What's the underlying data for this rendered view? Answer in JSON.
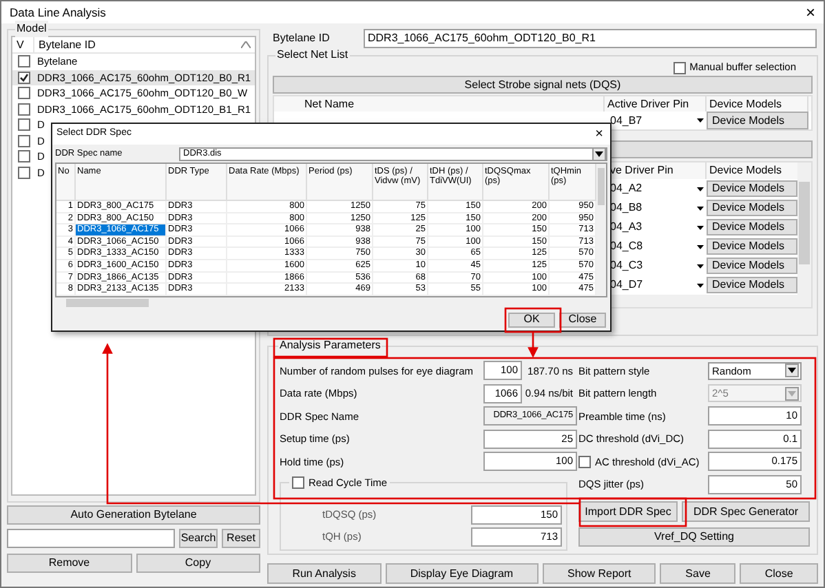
{
  "window": {
    "title": "Data Line Analysis",
    "close": "×"
  },
  "model": {
    "label": "Model",
    "columns": [
      "V",
      "Bytelane ID"
    ],
    "rows": [
      {
        "label": "Bytelane",
        "checked": false,
        "selected": false
      },
      {
        "label": "DDR3_1066_AC175_60ohm_ODT120_B0_R1",
        "checked": true,
        "selected": true
      },
      {
        "label": "DDR3_1066_AC175_60ohm_ODT120_B0_W",
        "checked": false,
        "selected": false
      },
      {
        "label": "DDR3_1066_AC175_60ohm_ODT120_B1_R1",
        "checked": false,
        "selected": false
      },
      {
        "label": "D",
        "checked": false,
        "selected": false
      },
      {
        "label": "D",
        "checked": false,
        "selected": false
      },
      {
        "label": "D",
        "checked": false,
        "selected": false
      },
      {
        "label": "D",
        "checked": false,
        "selected": false
      }
    ],
    "auto_button": "Auto Generation Bytelane",
    "search_button": "Search",
    "reset_button": "Reset",
    "remove_button": "Remove",
    "copy_button": "Copy"
  },
  "bytelane_id": {
    "label": "Bytelane ID",
    "value": "DDR3_1066_AC175_60ohm_ODT120_B0_R1"
  },
  "net_list": {
    "label": "Select Net List",
    "manual_buffer": {
      "label": "Manual buffer selection",
      "checked": false
    },
    "strobe_button": "Select Strobe signal nets (DQS)",
    "strobe_table": {
      "columns": [
        "Net Name",
        "Active Driver Pin",
        "Device Models"
      ],
      "rows": [
        {
          "pin": "04_B7",
          "model": "Device Models"
        }
      ]
    },
    "data_table": {
      "columns": [
        "ve Driver Pin",
        "Device Models"
      ],
      "rows": [
        {
          "pin": "04_A2",
          "model": "Device Models"
        },
        {
          "pin": "04_B8",
          "model": "Device Models"
        },
        {
          "pin": "04_A3",
          "model": "Device Models"
        },
        {
          "pin": "04_C8",
          "model": "Device Models"
        },
        {
          "pin": "04_C3",
          "model": "Device Models"
        },
        {
          "pin": "04_D7",
          "model": "Device Models"
        }
      ]
    }
  },
  "dialog": {
    "title": "Select DDR Spec",
    "close": "×",
    "spec_label": "DDR Spec name",
    "spec_value": "DDR3.dis",
    "columns": [
      "No",
      "Name",
      "DDR Type",
      "Data Rate (Mbps)",
      "Period (ps)",
      "tDS (ps) / Vidvw (mV)",
      "tDH (ps) / TdiVW(UI)",
      "tDQSQmax (ps)",
      "tQHmin (ps)"
    ],
    "rows": [
      {
        "cells": [
          "1",
          "DDR3_800_AC175",
          "DDR3",
          "800",
          "1250",
          "75",
          "150",
          "200",
          "950"
        ],
        "selected": false
      },
      {
        "cells": [
          "2",
          "DDR3_800_AC150",
          "DDR3",
          "800",
          "1250",
          "125",
          "150",
          "200",
          "950"
        ],
        "selected": false
      },
      {
        "cells": [
          "3",
          "DDR3_1066_AC175",
          "DDR3",
          "1066",
          "938",
          "25",
          "100",
          "150",
          "713"
        ],
        "selected": true
      },
      {
        "cells": [
          "4",
          "DDR3_1066_AC150",
          "DDR3",
          "1066",
          "938",
          "75",
          "100",
          "150",
          "713"
        ],
        "selected": false
      },
      {
        "cells": [
          "5",
          "DDR3_1333_AC150",
          "DDR3",
          "1333",
          "750",
          "30",
          "65",
          "125",
          "570"
        ],
        "selected": false
      },
      {
        "cells": [
          "6",
          "DDR3_1600_AC150",
          "DDR3",
          "1600",
          "625",
          "10",
          "45",
          "125",
          "570"
        ],
        "selected": false
      },
      {
        "cells": [
          "7",
          "DDR3_1866_AC135",
          "DDR3",
          "1866",
          "536",
          "68",
          "70",
          "100",
          "475"
        ],
        "selected": false
      },
      {
        "cells": [
          "8",
          "DDR3_2133_AC135",
          "DDR3",
          "2133",
          "469",
          "53",
          "55",
          "100",
          "475"
        ],
        "selected": false
      }
    ],
    "ok_button": "OK",
    "close_button": "Close"
  },
  "analysis": {
    "label": "Analysis Parameters",
    "left": [
      {
        "kind": "input",
        "label": "Number of random pulses for eye diagram",
        "value": "100",
        "unit": "187.70 ns"
      },
      {
        "kind": "input",
        "label": "Data rate (Mbps)",
        "value": "1066",
        "unit": "0.94 ns/bit"
      },
      {
        "kind": "readonly",
        "label": "DDR Spec Name",
        "value": "DDR3_1066_AC175"
      },
      {
        "kind": "wide",
        "label": "Setup time (ps)",
        "value": "25"
      },
      {
        "kind": "wide",
        "label": "Hold time (ps)",
        "value": "100"
      }
    ],
    "read_cycle": {
      "label": "Read Cycle Time",
      "checked": false,
      "fields": [
        {
          "label": "tDQSQ (ps)",
          "value": "150"
        },
        {
          "label": "tQH (ps)",
          "value": "713"
        }
      ]
    },
    "right": [
      {
        "kind": "select",
        "label": "Bit pattern style",
        "value": "Random",
        "disabled": false
      },
      {
        "kind": "select",
        "label": "Bit pattern length",
        "value": "2^5",
        "disabled": true
      },
      {
        "kind": "input",
        "label": "Preamble time (ns)",
        "value": "10"
      },
      {
        "kind": "input",
        "label": "DC threshold (dVi_DC)",
        "value": "0.1"
      },
      {
        "kind": "check_input",
        "label": "AC threshold (dVi_AC)",
        "value": "0.175",
        "checked": false
      },
      {
        "kind": "input",
        "label": "DQS jitter (ps)",
        "value": "50"
      }
    ],
    "import_button": "Import DDR Spec",
    "generator_button": "DDR Spec Generator",
    "vref_button": "Vref_DQ Setting"
  },
  "footer": [
    "Run Analysis",
    "Display Eye Diagram",
    "Show Report",
    "Save",
    "Close"
  ]
}
